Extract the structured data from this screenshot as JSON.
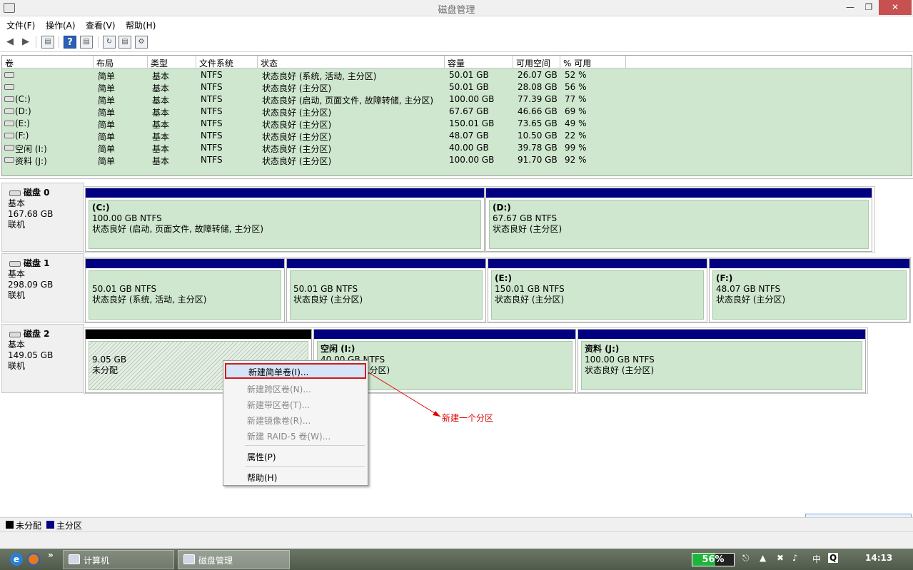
{
  "window": {
    "title": "磁盘管理"
  },
  "menu": [
    "文件(F)",
    "操作(A)",
    "查看(V)",
    "帮助(H)"
  ],
  "volume_list": {
    "columns": [
      "卷",
      "布局",
      "类型",
      "文件系统",
      "状态",
      "容量",
      "可用空间",
      "% 可用"
    ],
    "rows": [
      {
        "name": "",
        "layout": "简单",
        "type": "基本",
        "fs": "NTFS",
        "status": "状态良好 (系统, 活动, 主分区)",
        "capacity": "50.01 GB",
        "free": "26.07 GB",
        "pct": "52 %"
      },
      {
        "name": "",
        "layout": "简单",
        "type": "基本",
        "fs": "NTFS",
        "status": "状态良好 (主分区)",
        "capacity": "50.01 GB",
        "free": "28.08 GB",
        "pct": "56 %"
      },
      {
        "name": "(C:)",
        "layout": "简单",
        "type": "基本",
        "fs": "NTFS",
        "status": "状态良好 (启动, 页面文件, 故障转储, 主分区)",
        "capacity": "100.00 GB",
        "free": "77.39 GB",
        "pct": "77 %"
      },
      {
        "name": "(D:)",
        "layout": "简单",
        "type": "基本",
        "fs": "NTFS",
        "status": "状态良好 (主分区)",
        "capacity": "67.67 GB",
        "free": "46.66 GB",
        "pct": "69 %"
      },
      {
        "name": "(E:)",
        "layout": "简单",
        "type": "基本",
        "fs": "NTFS",
        "status": "状态良好 (主分区)",
        "capacity": "150.01 GB",
        "free": "73.65 GB",
        "pct": "49 %"
      },
      {
        "name": "(F:)",
        "layout": "简单",
        "type": "基本",
        "fs": "NTFS",
        "status": "状态良好 (主分区)",
        "capacity": "48.07 GB",
        "free": "10.50 GB",
        "pct": "22 %"
      },
      {
        "name": "空闲 (I:)",
        "layout": "简单",
        "type": "基本",
        "fs": "NTFS",
        "status": "状态良好 (主分区)",
        "capacity": "40.00 GB",
        "free": "39.78 GB",
        "pct": "99 %"
      },
      {
        "name": "资料 (J:)",
        "layout": "简单",
        "type": "基本",
        "fs": "NTFS",
        "status": "状态良好 (主分区)",
        "capacity": "100.00 GB",
        "free": "91.70 GB",
        "pct": "92 %"
      }
    ]
  },
  "disks": [
    {
      "name": "磁盘 0",
      "type": "基本",
      "size": "167.68 GB",
      "state": "联机",
      "partitions": [
        {
          "name": "(C:)",
          "size": "100.00 GB NTFS",
          "status": "状态良好 (启动, 页面文件, 故障转储, 主分区)"
        },
        {
          "name": "(D:)",
          "size": "67.67 GB NTFS",
          "status": "状态良好 (主分区)"
        }
      ]
    },
    {
      "name": "磁盘 1",
      "type": "基本",
      "size": "298.09 GB",
      "state": "联机",
      "partitions": [
        {
          "name": "",
          "size": "50.01 GB NTFS",
          "status": "状态良好 (系统, 活动, 主分区)"
        },
        {
          "name": "",
          "size": "50.01 GB NTFS",
          "status": "状态良好 (主分区)"
        },
        {
          "name": "(E:)",
          "size": "150.01 GB NTFS",
          "status": "状态良好 (主分区)"
        },
        {
          "name": "(F:)",
          "size": "48.07 GB NTFS",
          "status": "状态良好 (主分区)"
        }
      ]
    },
    {
      "name": "磁盘 2",
      "type": "基本",
      "size": "149.05 GB",
      "state": "联机",
      "partitions": [
        {
          "name": "",
          "size": "9.05 GB",
          "status": "未分配"
        },
        {
          "name": "空闲  (I:)",
          "size": "40.00 GB NTFS",
          "status": "状态良好 (主分区)"
        },
        {
          "name": "资料  (J:)",
          "size": "100.00 GB NTFS",
          "status": "状态良好 (主分区)"
        }
      ]
    }
  ],
  "context_menu": {
    "items": [
      {
        "label": "新建简单卷(I)...",
        "enabled": true
      },
      {
        "label": "新建跨区卷(N)...",
        "enabled": false
      },
      {
        "label": "新建带区卷(T)...",
        "enabled": false
      },
      {
        "label": "新建镜像卷(R)...",
        "enabled": false
      },
      {
        "label": "新建 RAID-5 卷(W)...",
        "enabled": false
      },
      {
        "label": "属性(P)",
        "enabled": true
      },
      {
        "label": "帮助(H)",
        "enabled": true
      }
    ]
  },
  "annotation": "新建一个分区",
  "legend": {
    "unallocated": "未分配",
    "primary": "主分区"
  },
  "colors": {
    "primary_bar": "#000080",
    "unallocated_bar": "#000000",
    "volume_bg": "#cfe7cf",
    "highlight_border": "#d21a1a"
  },
  "ime": {
    "label": "中"
  },
  "taskbar": {
    "buttons": [
      "计算机",
      "磁盘管理"
    ],
    "battery": "56%",
    "battery_level": 0.56,
    "ime": "中",
    "clock": "14:13"
  }
}
